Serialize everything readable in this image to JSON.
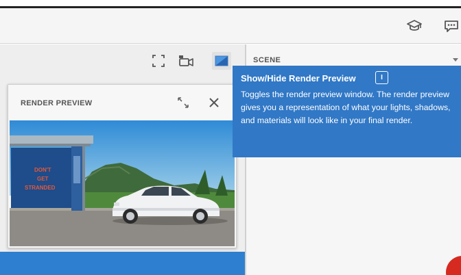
{
  "header": {
    "icons": [
      "learn-icon",
      "chat-icon"
    ]
  },
  "toolbar": {
    "icons": [
      "fullscreen-icon",
      "camera-icon",
      "render-preview-icon"
    ]
  },
  "scene_panel": {
    "title": "SCENE"
  },
  "render_preview": {
    "title": "RENDER PREVIEW",
    "icons": [
      "resize-icon",
      "close-icon"
    ],
    "poster_text": [
      "DON'T",
      "GET",
      "STRANDED"
    ]
  },
  "tooltip": {
    "title": "Show/Hide Render Preview",
    "shortcut": "I",
    "body": "Toggles the render preview window. The render preview gives you a representation of what your lights, shadows, and materials will look like in your final render."
  },
  "colors": {
    "tooltip_bg": "#3178c6",
    "accent_blue": "#2f7fd0",
    "badge_red": "#d62a20"
  }
}
